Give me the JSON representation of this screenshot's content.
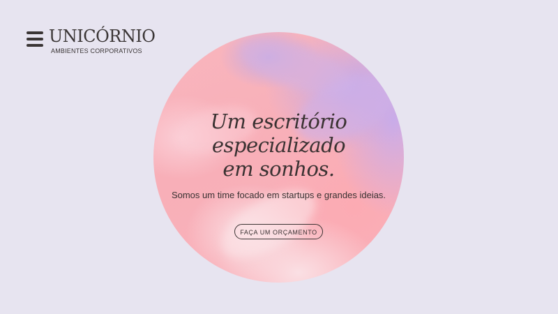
{
  "colors": {
    "background": "#e7e4f0",
    "text": "#3a3232",
    "circle_pink": "#f8afb8",
    "circle_lavender": "#c4aae8"
  },
  "header": {
    "menu_icon": "hamburger-menu-icon",
    "brand_name": "UNICÓRNIO",
    "brand_subtitle": "AMBIENTES CORPORATIVOS"
  },
  "hero": {
    "title_lines": [
      "Um escritório",
      "especializado",
      "em sonhos."
    ],
    "subtitle": "Somos um time focado em startups e grandes ideias.",
    "cta_label": "FAÇA UM ORÇAMENTO"
  }
}
